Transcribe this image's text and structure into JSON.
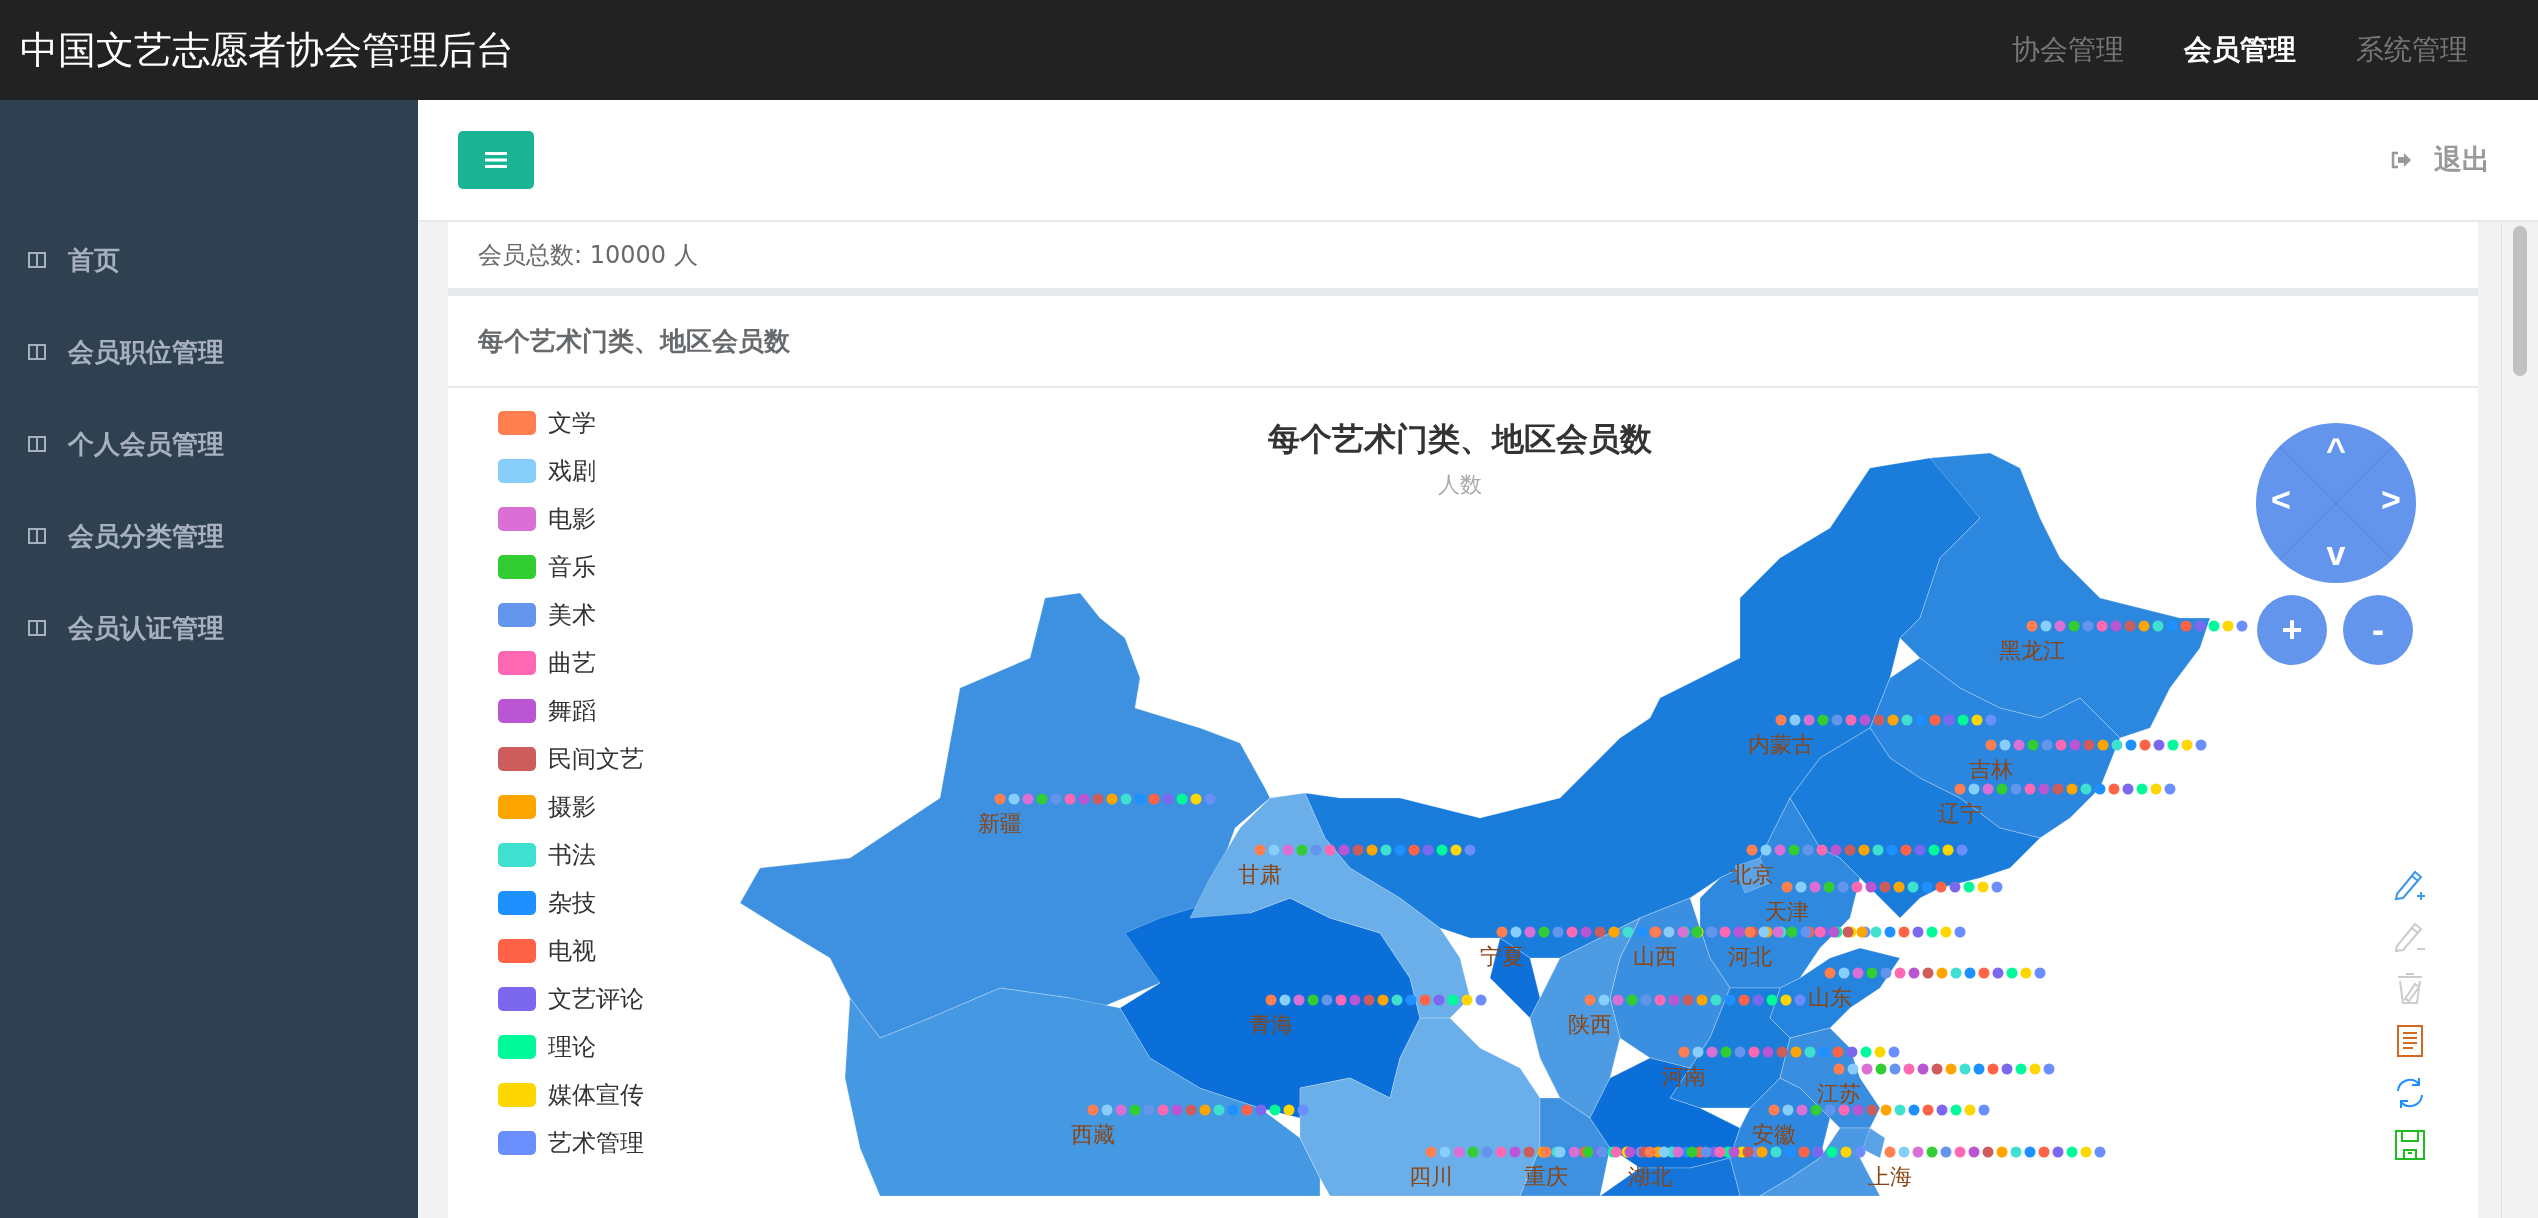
{
  "topbar": {
    "title": "中国文艺志愿者协会管理后台",
    "nav": [
      {
        "label": "协会管理",
        "selected": false
      },
      {
        "label": "会员管理",
        "selected": true
      },
      {
        "label": "系统管理",
        "selected": false
      }
    ]
  },
  "sidebar": {
    "items": [
      {
        "label": "首页"
      },
      {
        "label": "会员职位管理"
      },
      {
        "label": "个人会员管理"
      },
      {
        "label": "会员分类管理"
      },
      {
        "label": "会员认证管理"
      }
    ]
  },
  "header": {
    "logout": "退出"
  },
  "summary": "会员总数: 10000 人",
  "panel": {
    "title": "每个艺术门类、地区会员数",
    "chart": {
      "title": "每个艺术门类、地区会员数",
      "subtitle": "人数",
      "legend": [
        {
          "name": "文学",
          "color": "#ff7f50"
        },
        {
          "name": "戏剧",
          "color": "#87cefa"
        },
        {
          "name": "电影",
          "color": "#da70d6"
        },
        {
          "name": "音乐",
          "color": "#32cd32"
        },
        {
          "name": "美术",
          "color": "#6495ed"
        },
        {
          "name": "曲艺",
          "color": "#ff69b4"
        },
        {
          "name": "舞蹈",
          "color": "#ba55d3"
        },
        {
          "name": "民间文艺",
          "color": "#cd5c5c"
        },
        {
          "name": "摄影",
          "color": "#ffa500"
        },
        {
          "name": "书法",
          "color": "#40e0d0"
        },
        {
          "name": "杂技",
          "color": "#1e90ff"
        },
        {
          "name": "电视",
          "color": "#ff6347"
        },
        {
          "name": "文艺评论",
          "color": "#7b68ee"
        },
        {
          "name": "理论",
          "color": "#00fa9a"
        },
        {
          "name": "媒体宣传",
          "color": "#ffd700"
        },
        {
          "name": "艺术管理",
          "color": "#6b8eff"
        }
      ],
      "provinces": [
        "黑龙江",
        "内蒙古",
        "吉林",
        "新疆",
        "辽宁",
        "甘肃",
        "北京",
        "天津",
        "宁夏",
        "山西",
        "河北",
        "山东",
        "青海",
        "陕西",
        "河南",
        "江苏",
        "西藏",
        "安徽",
        "四川",
        "重庆",
        "湖北",
        "上海"
      ],
      "roam": {
        "up": "^",
        "left": "<",
        "right": ">",
        "down": "v",
        "zoom_in": "+",
        "zoom_out": "-"
      },
      "toolbox": [
        {
          "kind": "mark",
          "disabled": false
        },
        {
          "kind": "mark_undo",
          "disabled": true
        },
        {
          "kind": "mark_clear",
          "disabled": true
        },
        {
          "kind": "data_view",
          "disabled": false
        },
        {
          "kind": "restore",
          "disabled": false
        },
        {
          "kind": "save",
          "disabled": false
        }
      ]
    }
  }
}
